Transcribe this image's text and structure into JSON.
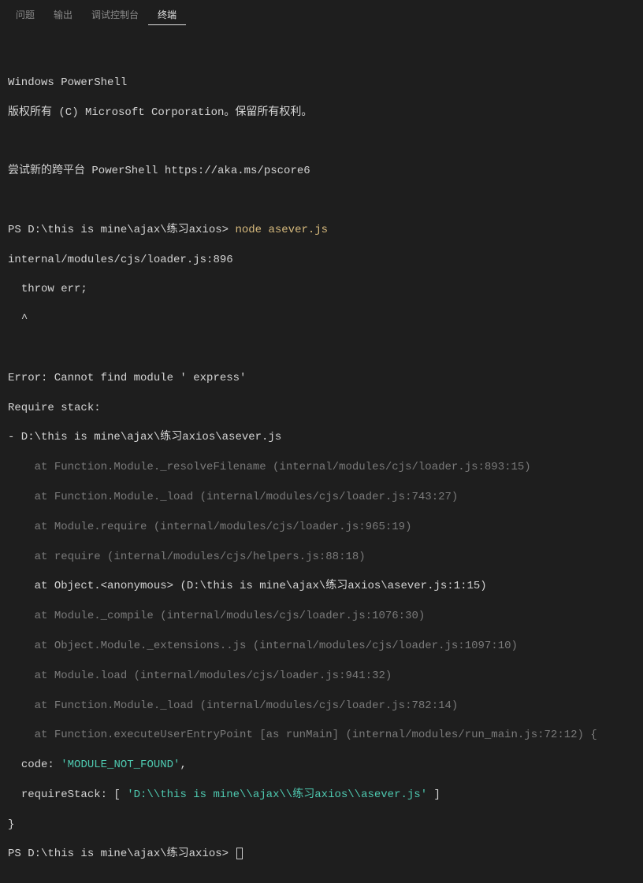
{
  "tabs": {
    "items": [
      {
        "label": "问题",
        "active": false
      },
      {
        "label": "输出",
        "active": false
      },
      {
        "label": "调试控制台",
        "active": false
      },
      {
        "label": "终端",
        "active": true
      }
    ]
  },
  "terminal": {
    "intro": {
      "line1": "Windows PowerShell",
      "line2": "版权所有 (C) Microsoft Corporation。保留所有权利。",
      "line3": "尝试新的跨平台 PowerShell https://aka.ms/pscore6"
    },
    "prompt1": {
      "path": "PS D:\\this is mine\\ajax\\练习axios> ",
      "command": "node asever.js"
    },
    "output": {
      "l1": "internal/modules/cjs/loader.js:896",
      "l2": "  throw err;",
      "l3": "  ^",
      "err1": "Error: Cannot find module ' express'",
      "err2": "Require stack:",
      "err3": "- D:\\this is mine\\ajax\\练习axios\\asever.js",
      "stack": [
        "    at Function.Module._resolveFilename (internal/modules/cjs/loader.js:893:15)",
        "    at Function.Module._load (internal/modules/cjs/loader.js:743:27)",
        "    at Module.require (internal/modules/cjs/loader.js:965:19)",
        "    at require (internal/modules/cjs/helpers.js:88:18)"
      ],
      "stack_highlight": "    at Object.<anonymous> (D:\\this is mine\\ajax\\练习axios\\asever.js:1:15)",
      "stack2": [
        "    at Module._compile (internal/modules/cjs/loader.js:1076:30)",
        "    at Object.Module._extensions..js (internal/modules/cjs/loader.js:1097:10)",
        "    at Module.load (internal/modules/cjs/loader.js:941:32)",
        "    at Function.Module._load (internal/modules/cjs/loader.js:782:14)",
        "    at Function.executeUserEntryPoint [as runMain] (internal/modules/run_main.js:72:12) {"
      ],
      "code_label": "  code: ",
      "code_value": "'MODULE_NOT_FOUND'",
      "code_comma": ",",
      "reqstack_label": "  requireStack: [ ",
      "reqstack_value": "'D:\\\\this is mine\\\\ajax\\\\练习axios\\\\asever.js'",
      "reqstack_close": " ]",
      "brace": "}"
    },
    "prompt2": {
      "path": "PS D:\\this is mine\\ajax\\练习axios> "
    }
  }
}
